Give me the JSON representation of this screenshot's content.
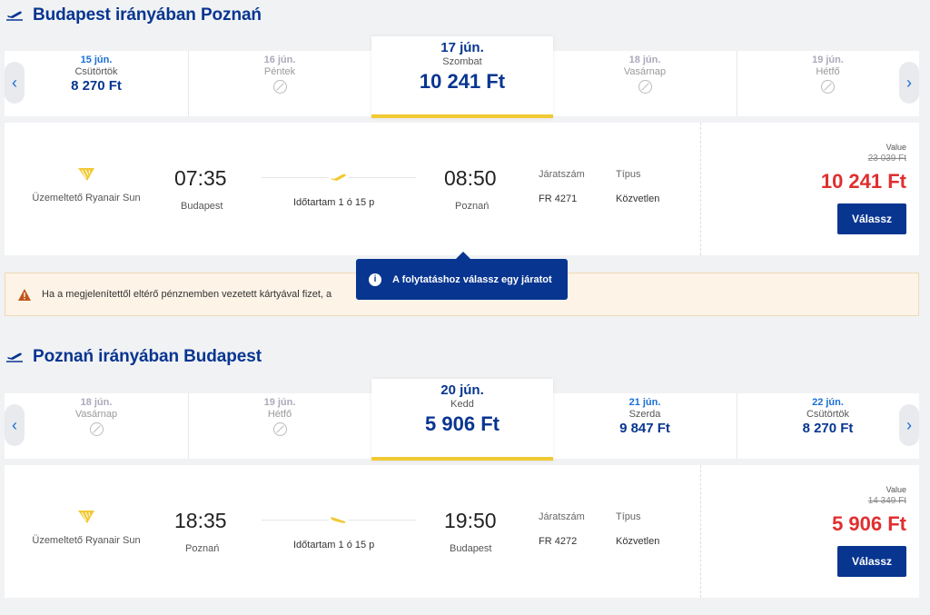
{
  "outbound": {
    "title": "Budapest irányában Poznań",
    "dates": [
      {
        "date": "15 jún.",
        "day": "Csütörtök",
        "price": "8 270 Ft",
        "available": true
      },
      {
        "date": "16 jún.",
        "day": "Péntek",
        "price": "",
        "available": false
      },
      {
        "date": "17 jún.",
        "day": "Szombat",
        "price": "10 241 Ft",
        "available": true,
        "selected": true
      },
      {
        "date": "18 jún.",
        "day": "Vasárnap",
        "price": "",
        "available": false
      },
      {
        "date": "19 jún.",
        "day": "Hétfő",
        "price": "",
        "available": false
      }
    ],
    "flight": {
      "operator": "Üzemeltető Ryanair Sun",
      "depart_time": "07:35",
      "depart_city": "Budapest",
      "duration": "Időtartam 1 ó 15 p",
      "arrive_time": "08:50",
      "arrive_city": "Poznań",
      "flight_no_label": "Járatszám",
      "flight_no": "FR 4271",
      "type_label": "Típus",
      "type": "Közvetlen",
      "fare_type": "Value",
      "old_price": "23 039 Ft",
      "price": "10 241 Ft",
      "select_label": "Válassz"
    }
  },
  "warning": {
    "text": "Ha a megjelenítettől eltérő pénznemben vezetett kártyával fizet, a"
  },
  "tooltip": {
    "text": "A folytatáshoz válassz egy járatot"
  },
  "inbound": {
    "title": "Poznań irányában Budapest",
    "dates": [
      {
        "date": "18 jún.",
        "day": "Vasárnap",
        "price": "",
        "available": false
      },
      {
        "date": "19 jún.",
        "day": "Hétfő",
        "price": "",
        "available": false
      },
      {
        "date": "20 jún.",
        "day": "Kedd",
        "price": "5 906 Ft",
        "available": true,
        "selected": true
      },
      {
        "date": "21 jún.",
        "day": "Szerda",
        "price": "9 847 Ft",
        "available": true
      },
      {
        "date": "22 jún.",
        "day": "Csütörtök",
        "price": "8 270 Ft",
        "available": true
      }
    ],
    "flight": {
      "operator": "Üzemeltető Ryanair Sun",
      "depart_time": "18:35",
      "depart_city": "Poznań",
      "duration": "Időtartam 1 ó 15 p",
      "arrive_time": "19:50",
      "arrive_city": "Budapest",
      "flight_no_label": "Járatszám",
      "flight_no": "FR 4272",
      "type_label": "Típus",
      "type": "Közvetlen",
      "fare_type": "Value",
      "old_price": "14 349 Ft",
      "price": "5 906 Ft",
      "select_label": "Válassz"
    }
  },
  "colors": {
    "brand_blue": "#073590",
    "link_blue": "#1a6fd4",
    "accent_yellow": "#f1c933",
    "price_red": "#e02f2f"
  },
  "icons": {
    "nav_prev": "chevron-left-icon",
    "nav_next": "chevron-right-icon",
    "takeoff": "plane-takeoff-icon",
    "landing": "plane-landing-icon",
    "unavailable": "no-flight-icon",
    "warning": "warning-icon",
    "info": "info-icon"
  }
}
